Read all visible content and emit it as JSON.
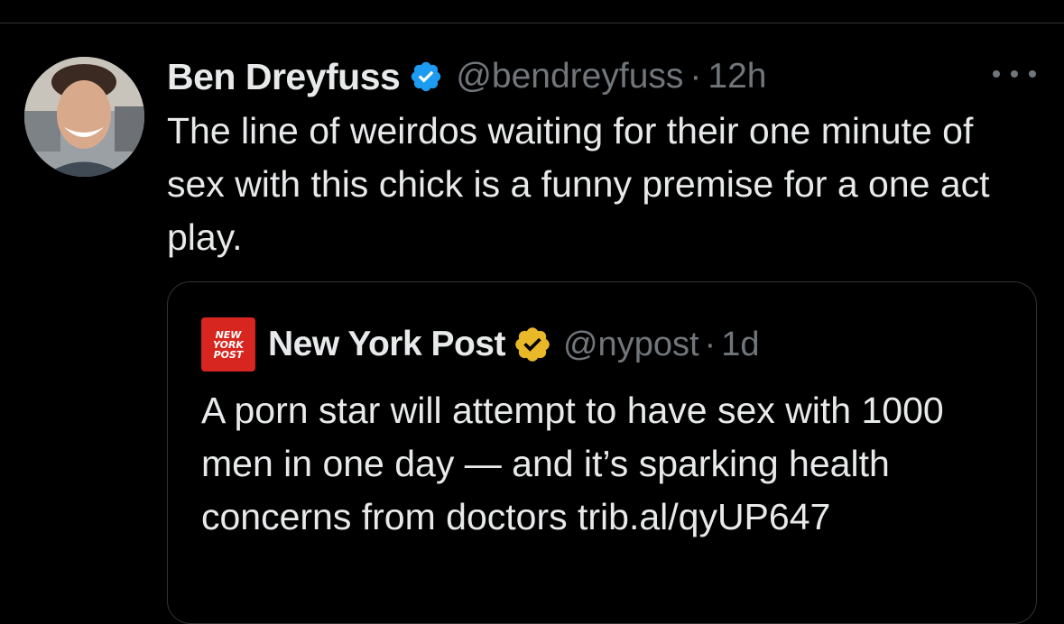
{
  "tweet": {
    "author_name": "Ben Dreyfuss",
    "handle": "@bendreyfuss",
    "separator": "·",
    "time": "12h",
    "verified_badge": "blue-check-icon",
    "avatar": "avatar-photo",
    "more_icon": "more-horizontal-icon",
    "text": "The line of weirdos waiting for their one minute of sex with this chick is a funny premise for a one act play."
  },
  "quoted_tweet": {
    "logo_lines": [
      "NEW",
      "YORK",
      "POST"
    ],
    "author_name": "New York Post",
    "handle": "@nypost",
    "separator": "·",
    "time": "1d",
    "verified_badge": "gold-check-icon",
    "text": "A porn star will attempt to have sex with 1000 men in one day — and it’s sparking health concerns from doctors trib.al/qyUP647"
  },
  "colors": {
    "background": "#000000",
    "text_primary": "#e7e9ea",
    "text_secondary": "#71767b",
    "border": "#2f3336",
    "verified_blue": "#1d9bf0",
    "verified_gold": "#e8b829",
    "nypost_red": "#d7251f"
  }
}
